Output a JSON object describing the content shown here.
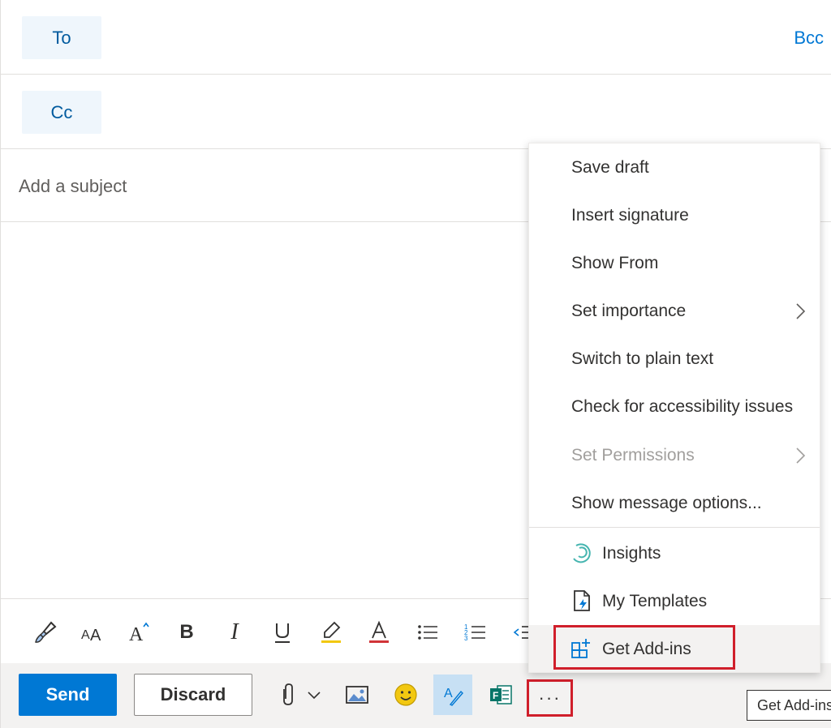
{
  "recipients": {
    "to_label": "To",
    "cc_label": "Cc",
    "bcc_label": "Bcc"
  },
  "subject": {
    "placeholder": "Add a subject",
    "value": ""
  },
  "toolbar": {
    "send_label": "Send",
    "discard_label": "Discard",
    "more_label": "···"
  },
  "icons": {
    "format_painter": "paintbrush-icon",
    "font_size": "font-size-icon",
    "grow_font": "grow-font-icon",
    "bold": "bold-icon",
    "italic": "italic-icon",
    "underline": "underline-icon",
    "highlight": "highlight-icon",
    "font_color": "font-color-icon",
    "bullets": "bullets-icon",
    "numbering": "numbering-icon",
    "attach": "paperclip-icon",
    "picture": "image-icon",
    "emoji": "emoji-icon",
    "editor": "editor-icon",
    "forms": "forms-icon"
  },
  "menu": {
    "items": [
      {
        "label": "Save draft"
      },
      {
        "label": "Insert signature"
      },
      {
        "label": "Show From"
      },
      {
        "label": "Set importance",
        "submenu": true
      },
      {
        "label": "Switch to plain text"
      },
      {
        "label": "Check for accessibility issues"
      },
      {
        "label": "Set Permissions",
        "submenu": true,
        "disabled": true
      },
      {
        "label": "Show message options..."
      }
    ],
    "addins": [
      {
        "label": "Insights",
        "icon": "insights-icon"
      },
      {
        "label": "My Templates",
        "icon": "templates-icon"
      },
      {
        "label": "Get Add-ins",
        "icon": "add-ins-icon"
      }
    ]
  },
  "tooltip": {
    "text": "Get Add-ins"
  },
  "colors": {
    "accent": "#0078d4",
    "highlight_box": "#d01f2b",
    "emoji": "#f2c811",
    "forms": "#077568",
    "insights": "#46b5b0"
  }
}
